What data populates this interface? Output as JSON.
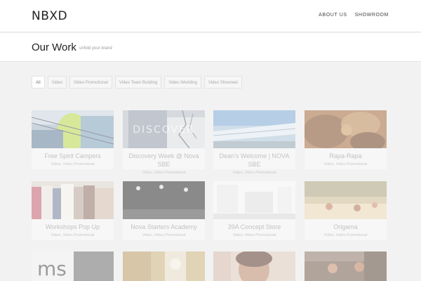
{
  "brand": {
    "logo": "NBXD"
  },
  "nav": [
    {
      "label": "ABOUT US"
    },
    {
      "label": "SHOWROOM"
    }
  ],
  "page": {
    "title": "Our Work",
    "tagline": "unfold your brand"
  },
  "filters": [
    {
      "label": "All",
      "active": true
    },
    {
      "label": "Video"
    },
    {
      "label": "Video Promotional"
    },
    {
      "label": "Video Team Building"
    },
    {
      "label": "Video Wedding"
    },
    {
      "label": "Video Showreel"
    }
  ],
  "projects": [
    {
      "title": "Free Spirit Campers",
      "categories": "Video, Video Promotional"
    },
    {
      "title": "Discovery Week @ Nova SBE",
      "categories": "Video, Video Promotional",
      "thumb_text": "DISCOVER"
    },
    {
      "title": "Dean's Welcome | NOVA SBE",
      "categories": "Video, Video Promotional"
    },
    {
      "title": "Rapa-Rapa",
      "categories": "Video, Video Promotional"
    },
    {
      "title": "Workshops Pop Up",
      "categories": "Video, Video Promotional"
    },
    {
      "title": "Nova Starters Academy",
      "categories": "Video, Video Promotional"
    },
    {
      "title": "39A Concept Store",
      "categories": "Video, Video Promotional"
    },
    {
      "title": "Origama",
      "categories": "Video, Video Promotional"
    }
  ]
}
